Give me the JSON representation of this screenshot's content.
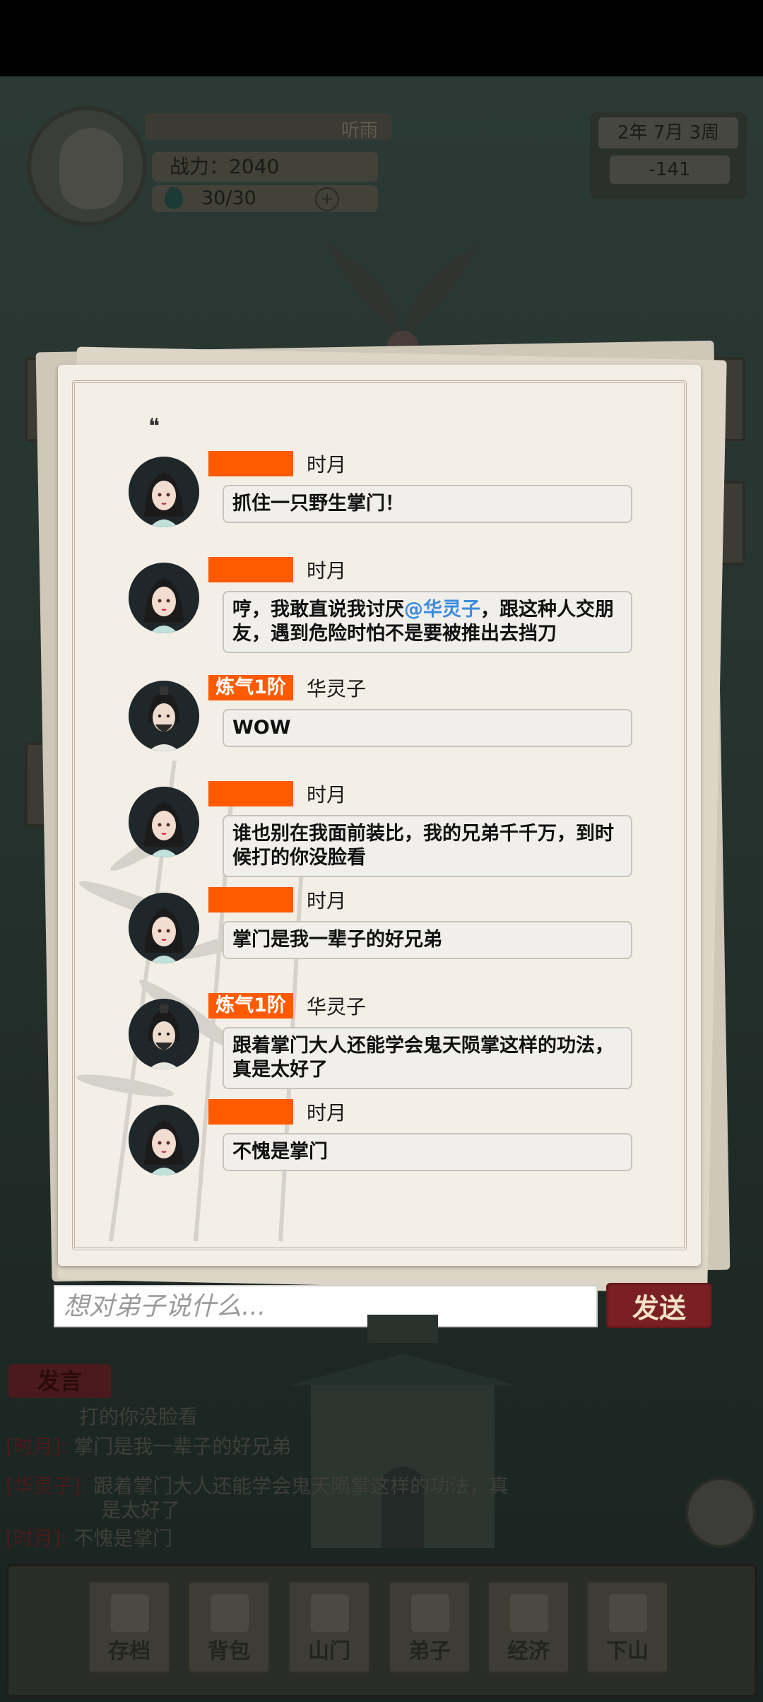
{
  "hud": {
    "player_name": "听雨",
    "power_label": "战力：2040",
    "stamina": "30/30",
    "date": "2年  7月  3周",
    "currency": "-141"
  },
  "messages": [
    {
      "badge": "",
      "name": "时月",
      "text": "抓住一只野生掌门！",
      "avatar": "female"
    },
    {
      "badge": "",
      "name": "时月",
      "text_before": "哼，我敢直说我讨厌",
      "mention": "@华灵子",
      "text_after": "，跟这种人交朋友，遇到危险时怕不是要被推出去挡刀",
      "avatar": "female"
    },
    {
      "badge": "炼气1阶",
      "name": "华灵子",
      "text": "WOW",
      "avatar": "male"
    },
    {
      "badge": "",
      "name": "时月",
      "text": "谁也别在我面前装比，我的兄弟千千万，到时候打的你没脸看",
      "avatar": "female"
    },
    {
      "badge": "",
      "name": "时月",
      "text": "掌门是我一辈子的好兄弟",
      "avatar": "female"
    },
    {
      "badge": "炼气1阶",
      "name": "华灵子",
      "text": "跟着掌门大人还能学会鬼天陨掌这样的功法，真是太好了",
      "avatar": "male"
    },
    {
      "badge": "",
      "name": "时月",
      "text": "不愧是掌门",
      "avatar": "female"
    }
  ],
  "input": {
    "placeholder": "想对弟子说什么..."
  },
  "send_label": "发送",
  "log": {
    "title": "发言",
    "lines": [
      {
        "tag": "",
        "text": "打的你没脸看"
      },
      {
        "tag": "[时月]:",
        "text": "掌门是我一辈子的好兄弟"
      },
      {
        "tag": "[华灵子]:",
        "text": "跟着掌门大人还能学会鬼天陨掌这样的功法，真"
      },
      {
        "tag": "",
        "text": "是太好了"
      },
      {
        "tag": "[时月]:",
        "text": "不愧是掌门"
      }
    ]
  },
  "nav": [
    "存档",
    "背包",
    "山门",
    "弟子",
    "经济",
    "下山"
  ],
  "colors": {
    "badge": "#ff5a00",
    "mention": "#3b8be0",
    "send": "#7a1f24"
  }
}
